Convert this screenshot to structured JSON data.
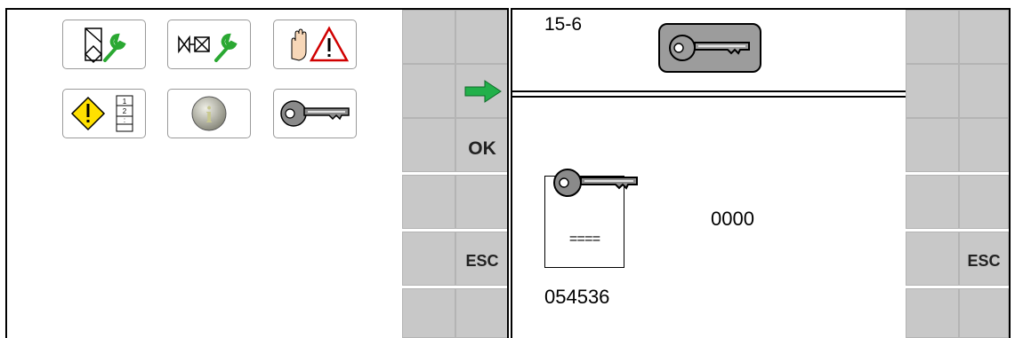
{
  "menu": {
    "icons": [
      {
        "name": "maintenance-wrench-icon"
      },
      {
        "name": "valve-wrench-icon"
      },
      {
        "name": "hand-warning-icon"
      },
      {
        "name": "alarm-list-icon"
      },
      {
        "name": "info-icon"
      },
      {
        "name": "key-icon"
      }
    ]
  },
  "softkeys_left": {
    "ok_label": "OK",
    "esc_label": "ESC",
    "arrow_icon": "green-arrow-right-icon"
  },
  "screen": {
    "title": "15-6",
    "header_icon": "key-icon",
    "code_value": "0000",
    "document_icon": "key-document-icon",
    "document_mask": "====",
    "serial": "054536"
  },
  "softkeys_right": {
    "esc_label": "ESC"
  },
  "colors": {
    "softkey_gray": "#c8c8c8",
    "arrow_green": "#22b04a",
    "wrench_green": "#2aa832",
    "warning_yellow": "#ffe000",
    "key_gray": "#8a8a8a"
  }
}
